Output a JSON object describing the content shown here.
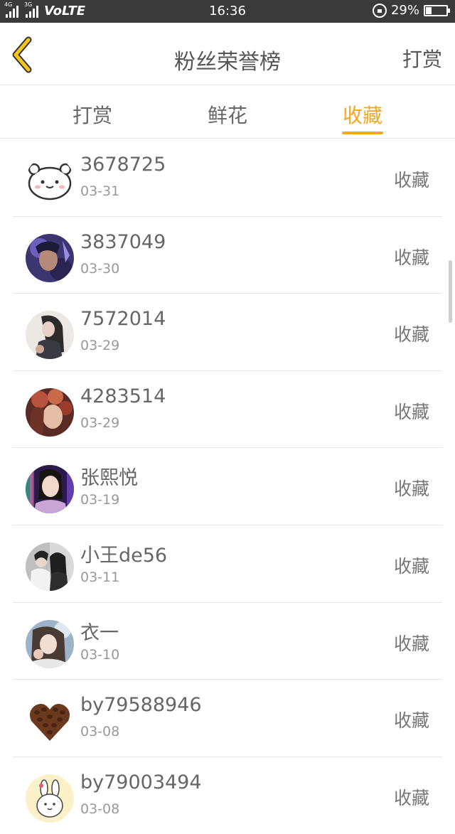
{
  "status_bar": {
    "network_left": "4G",
    "network_right": "3G",
    "volte": "VoLTE",
    "time": "16:36",
    "battery_percent": "29%",
    "battery_level": 0.29
  },
  "nav": {
    "back_icon": "chevron-left-icon",
    "title": "粉丝荣誉榜",
    "action": "打赏",
    "accent": "#f5a623"
  },
  "tabs": [
    {
      "label": "打赏",
      "active": false
    },
    {
      "label": "鲜花",
      "active": false
    },
    {
      "label": "收藏",
      "active": true
    }
  ],
  "fans": [
    {
      "name": "3678725",
      "date": "03-31",
      "action": "收藏",
      "avatar": "cartoon-bear"
    },
    {
      "name": "3837049",
      "date": "03-30",
      "action": "收藏",
      "avatar": "game-character"
    },
    {
      "name": "7572014",
      "date": "03-29",
      "action": "收藏",
      "avatar": "girl-photo"
    },
    {
      "name": "4283514",
      "date": "03-29",
      "action": "收藏",
      "avatar": "woman-flowers"
    },
    {
      "name": "张熙悦",
      "date": "03-19",
      "action": "收藏",
      "avatar": "woman-portrait"
    },
    {
      "name": "小王de56",
      "date": "03-11",
      "action": "收藏",
      "avatar": "couple-photo"
    },
    {
      "name": "衣一",
      "date": "03-10",
      "action": "收藏",
      "avatar": "girl-selfie"
    },
    {
      "name": "by79588946",
      "date": "03-08",
      "action": "收藏",
      "avatar": "coffee-heart"
    },
    {
      "name": "by79003494",
      "date": "03-08",
      "action": "收藏",
      "avatar": "cartoon-rabbit"
    }
  ]
}
